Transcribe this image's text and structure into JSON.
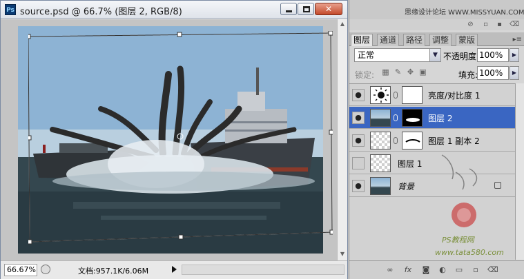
{
  "window": {
    "app_badge": "Ps",
    "title": "source.psd @ 66.7% (图层 2, RGB/8)"
  },
  "status": {
    "zoom": "66.67%",
    "doc_info": "文档:957.1K/6.06M"
  },
  "brand": {
    "text": "思缘设计论坛 WWW.MISSYUAN.COM"
  },
  "tabs": [
    "图层",
    "通道",
    "路径",
    "调整",
    "蒙版"
  ],
  "active_tab": "图层",
  "blend": {
    "mode": "正常",
    "opacity_label": "不透明度:",
    "opacity_value": "100%",
    "lock_label": "锁定:",
    "fill_label": "填充:",
    "fill_value": "100%"
  },
  "layers": [
    {
      "name": "亮度/对比度 1",
      "visible": true,
      "selected": false,
      "type": "adjustment"
    },
    {
      "name": "图层 2",
      "visible": true,
      "selected": true,
      "type": "masked"
    },
    {
      "name": "图层 1 副本 2",
      "visible": true,
      "selected": false,
      "type": "masked"
    },
    {
      "name": "图层 1",
      "visible": false,
      "selected": false,
      "type": "plain"
    },
    {
      "name": "背景",
      "visible": true,
      "selected": false,
      "type": "background"
    }
  ],
  "watermark": {
    "ps_text": "PS教程网",
    "url": "www.tata580.com"
  },
  "colors": {
    "selection": "#3a66c2",
    "panel_bg": "#d2d2d2",
    "window_frame": "#7a8aa3"
  }
}
